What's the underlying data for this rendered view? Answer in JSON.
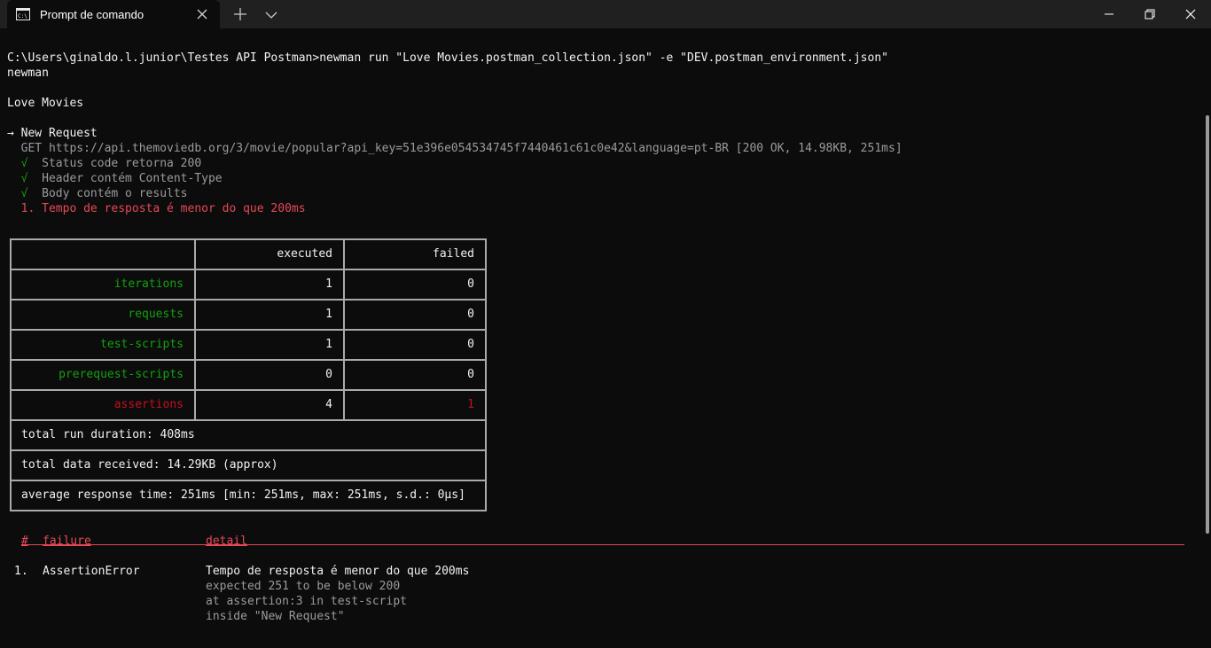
{
  "window": {
    "tab_title": "Prompt de comando",
    "icons": {
      "app": "cmd-icon",
      "close_tab": "close-icon",
      "new_tab": "plus-icon",
      "menu": "chevron-down-icon"
    }
  },
  "terminal": {
    "command_line": "C:\\Users\\ginaldo.l.junior\\Testes API Postman>newman run \"Love Movies.postman_collection.json\" -e \"DEV.postman_environment.json\"",
    "tool_name": "newman",
    "collection_name": "Love Movies",
    "request_name": "→ New Request",
    "request_line": "  GET https://api.themoviedb.org/3/movie/popular?api_key=51e396e054534745f7440461c61c0e42&language=pt-BR [200 OK, 14.98KB, 251ms]",
    "tests": [
      {
        "mark": "  √",
        "text": "  Status code retorna 200"
      },
      {
        "mark": "  √",
        "text": "  Header contém Content-Type"
      },
      {
        "mark": "  √",
        "text": "  Body contém o results"
      }
    ],
    "failed_test": "  1. Tempo de resposta é menor do que 200ms",
    "summary": {
      "columns": [
        "executed",
        "failed"
      ],
      "rows": [
        {
          "label": "iterations",
          "executed": "1",
          "failed": "0"
        },
        {
          "label": "requests",
          "executed": "1",
          "failed": "0"
        },
        {
          "label": "test-scripts",
          "executed": "1",
          "failed": "0"
        },
        {
          "label": "prerequest-scripts",
          "executed": "0",
          "failed": "0"
        },
        {
          "label": "assertions",
          "executed": "4",
          "failed": "1"
        }
      ],
      "total_run_duration": "total run duration: 408ms",
      "total_data_received": "total data received: 14.29KB (approx)",
      "average_response_time": "average response time: 251ms [min: 251ms, max: 251ms, s.d.: 0µs]"
    },
    "failures": {
      "headers": {
        "num": "#",
        "failure": "failure",
        "detail": "detail"
      },
      "items": [
        {
          "num": "1.",
          "failure": "AssertionError",
          "detail": "Tempo de resposta é menor do que 200ms",
          "extra": [
            "expected 251 to be below 200",
            "at assertion:3 in test-script",
            "inside \"New Request\""
          ]
        }
      ]
    }
  },
  "colors": {
    "background": "#0c0c0c",
    "titlebar": "#202020",
    "green": "#13a10e",
    "red": "#e74856"
  }
}
